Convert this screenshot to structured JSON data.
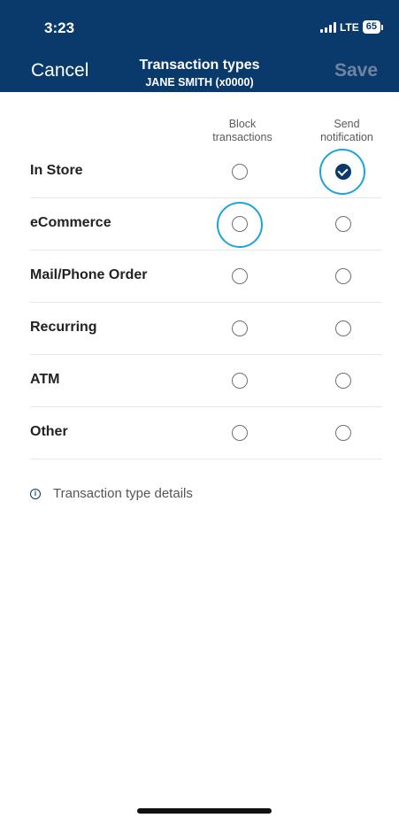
{
  "status_bar": {
    "time": "3:23",
    "network": "LTE",
    "battery": "65"
  },
  "nav": {
    "cancel_label": "Cancel",
    "title": "Transaction types",
    "subtitle": "JANE SMITH (x0000)",
    "save_label": "Save"
  },
  "columns": {
    "block": "Block\ntransactions",
    "send": "Send\nnotification"
  },
  "rows": [
    {
      "label": "In Store",
      "block": false,
      "send": true
    },
    {
      "label": "eCommerce",
      "block": false,
      "send": false
    },
    {
      "label": "Mail/Phone Order",
      "block": false,
      "send": false
    },
    {
      "label": "Recurring",
      "block": false,
      "send": false
    },
    {
      "label": "ATM",
      "block": false,
      "send": false
    },
    {
      "label": "Other",
      "block": false,
      "send": false
    }
  ],
  "details_link": {
    "label": "Transaction type details",
    "icon": "info-icon"
  },
  "colors": {
    "header_bg": "#0a3a6b",
    "accent": "#0a3a6b",
    "highlight": "#1da3dc"
  }
}
